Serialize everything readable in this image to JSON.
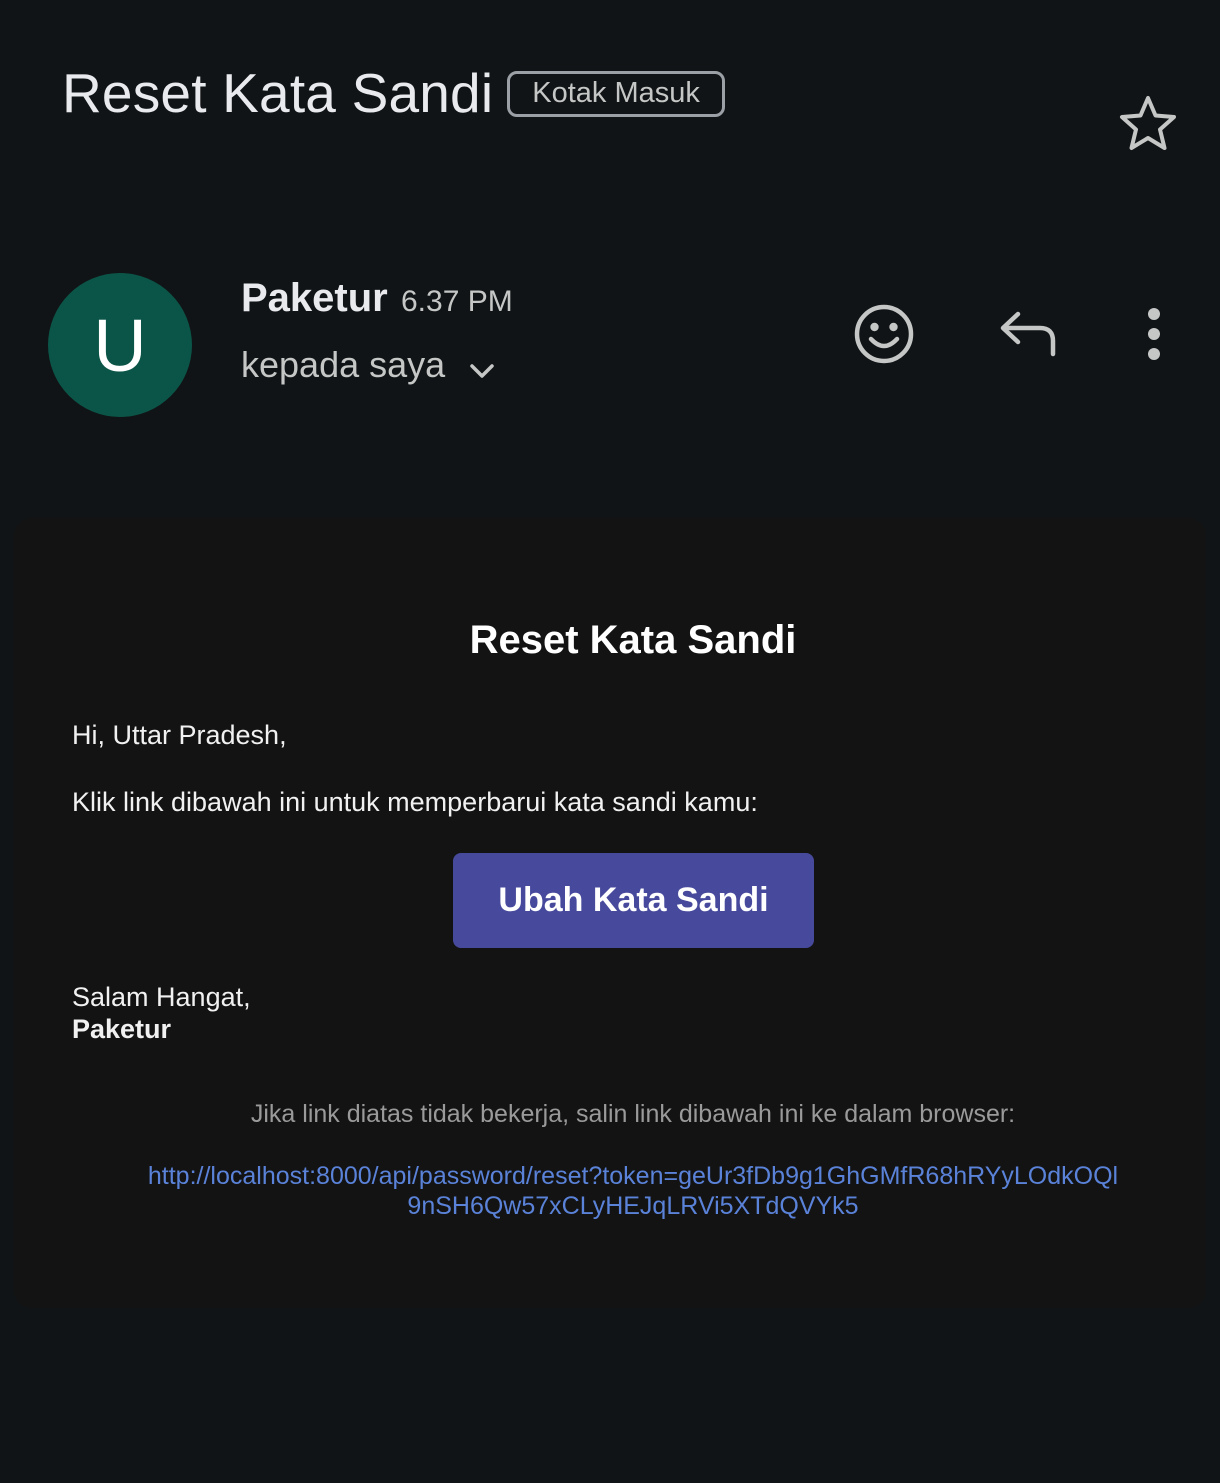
{
  "header": {
    "subject": "Reset Kata Sandi",
    "label": "Kotak Masuk",
    "star_icon": "star-outline-icon"
  },
  "sender": {
    "avatar_initial": "U",
    "avatar_color": "#0b5548",
    "name": "Paketur",
    "time": "6.37 PM",
    "recipient": "kepada saya"
  },
  "actions": {
    "icons": [
      "emoji-reaction-icon",
      "reply-icon",
      "more-vert-icon"
    ]
  },
  "email": {
    "heading": "Reset Kata Sandi",
    "greeting": "Hi, Uttar Pradesh,",
    "instruction": "Klik link dibawah ini untuk memperbarui kata sandi kamu:",
    "button_label": "Ubah Kata Sandi",
    "button_color": "#474a9c",
    "signoff": "Salam Hangat,",
    "signoff_name": "Paketur",
    "fallback_note": "Jika link diatas tidak bekerja, salin link dibawah ini ke dalam browser:",
    "fallback_link_line1": "http://localhost:8000/api/password/reset?token=geUr3fDb9g1GhGMfR68hRYyLOdkOQl",
    "fallback_link_line2": "9nSH6Qw57xCLyHEJqLRVi5XTdQVYk5",
    "link_color": "#5a82d8"
  }
}
